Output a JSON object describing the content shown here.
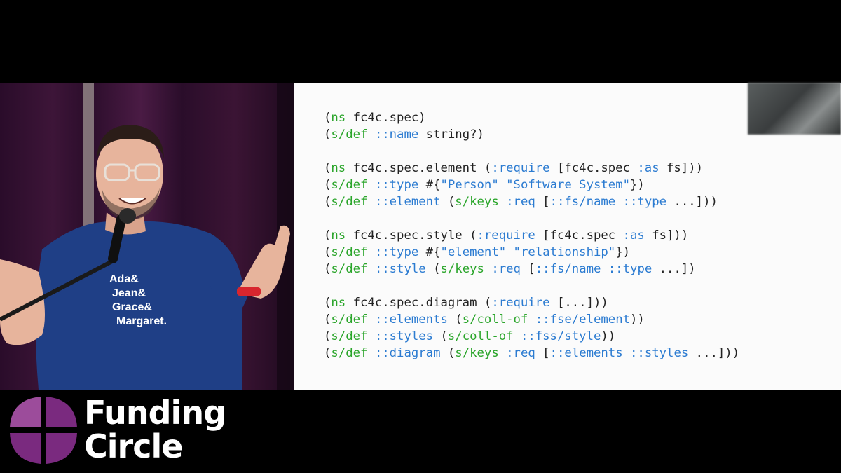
{
  "slide": {
    "code_lines": [
      [
        {
          "t": "(",
          "c": "plain"
        },
        {
          "t": "ns",
          "c": "form"
        },
        {
          "t": " fc4c.spec)",
          "c": "plain"
        }
      ],
      [
        {
          "t": "(",
          "c": "plain"
        },
        {
          "t": "s/def",
          "c": "form"
        },
        {
          "t": " ",
          "c": "plain"
        },
        {
          "t": "::name",
          "c": "kw"
        },
        {
          "t": " string?)",
          "c": "plain"
        }
      ],
      [],
      [
        {
          "t": "(",
          "c": "plain"
        },
        {
          "t": "ns",
          "c": "form"
        },
        {
          "t": " fc4c.spec.element (",
          "c": "plain"
        },
        {
          "t": ":require",
          "c": "kw"
        },
        {
          "t": " [fc4c.spec ",
          "c": "plain"
        },
        {
          "t": ":as",
          "c": "kw"
        },
        {
          "t": " fs]))",
          "c": "plain"
        }
      ],
      [
        {
          "t": "(",
          "c": "plain"
        },
        {
          "t": "s/def",
          "c": "form"
        },
        {
          "t": " ",
          "c": "plain"
        },
        {
          "t": "::type",
          "c": "kw"
        },
        {
          "t": " #{",
          "c": "plain"
        },
        {
          "t": "\"Person\" \"Software System\"",
          "c": "kw"
        },
        {
          "t": "})",
          "c": "plain"
        }
      ],
      [
        {
          "t": "(",
          "c": "plain"
        },
        {
          "t": "s/def",
          "c": "form"
        },
        {
          "t": " ",
          "c": "plain"
        },
        {
          "t": "::element",
          "c": "kw"
        },
        {
          "t": " (",
          "c": "plain"
        },
        {
          "t": "s/keys",
          "c": "form"
        },
        {
          "t": " ",
          "c": "plain"
        },
        {
          "t": ":req",
          "c": "kw"
        },
        {
          "t": " [",
          "c": "plain"
        },
        {
          "t": "::fs/name ::type",
          "c": "kw"
        },
        {
          "t": " ...]))",
          "c": "plain"
        }
      ],
      [],
      [
        {
          "t": "(",
          "c": "plain"
        },
        {
          "t": "ns",
          "c": "form"
        },
        {
          "t": " fc4c.spec.style (",
          "c": "plain"
        },
        {
          "t": ":require",
          "c": "kw"
        },
        {
          "t": " [fc4c.spec ",
          "c": "plain"
        },
        {
          "t": ":as",
          "c": "kw"
        },
        {
          "t": " fs]))",
          "c": "plain"
        }
      ],
      [
        {
          "t": "(",
          "c": "plain"
        },
        {
          "t": "s/def",
          "c": "form"
        },
        {
          "t": " ",
          "c": "plain"
        },
        {
          "t": "::type",
          "c": "kw"
        },
        {
          "t": " #{",
          "c": "plain"
        },
        {
          "t": "\"element\" \"relationship\"",
          "c": "kw"
        },
        {
          "t": "})",
          "c": "plain"
        }
      ],
      [
        {
          "t": "(",
          "c": "plain"
        },
        {
          "t": "s/def",
          "c": "form"
        },
        {
          "t": " ",
          "c": "plain"
        },
        {
          "t": "::style",
          "c": "kw"
        },
        {
          "t": " (",
          "c": "plain"
        },
        {
          "t": "s/keys",
          "c": "form"
        },
        {
          "t": " ",
          "c": "plain"
        },
        {
          "t": ":req",
          "c": "kw"
        },
        {
          "t": " [",
          "c": "plain"
        },
        {
          "t": "::fs/name ::type",
          "c": "kw"
        },
        {
          "t": " ...])",
          "c": "plain"
        }
      ],
      [],
      [
        {
          "t": "(",
          "c": "plain"
        },
        {
          "t": "ns",
          "c": "form"
        },
        {
          "t": " fc4c.spec.diagram (",
          "c": "plain"
        },
        {
          "t": ":require",
          "c": "kw"
        },
        {
          "t": " [...]))",
          "c": "plain"
        }
      ],
      [
        {
          "t": "(",
          "c": "plain"
        },
        {
          "t": "s/def",
          "c": "form"
        },
        {
          "t": " ",
          "c": "plain"
        },
        {
          "t": "::elements",
          "c": "kw"
        },
        {
          "t": " (",
          "c": "plain"
        },
        {
          "t": "s/coll-of",
          "c": "form"
        },
        {
          "t": " ",
          "c": "plain"
        },
        {
          "t": "::fse/element",
          "c": "kw"
        },
        {
          "t": "))",
          "c": "plain"
        }
      ],
      [
        {
          "t": "(",
          "c": "plain"
        },
        {
          "t": "s/def",
          "c": "form"
        },
        {
          "t": " ",
          "c": "plain"
        },
        {
          "t": "::styles",
          "c": "kw"
        },
        {
          "t": " (",
          "c": "plain"
        },
        {
          "t": "s/coll-of",
          "c": "form"
        },
        {
          "t": " ",
          "c": "plain"
        },
        {
          "t": "::fss/style",
          "c": "kw"
        },
        {
          "t": "))",
          "c": "plain"
        }
      ],
      [
        {
          "t": "(",
          "c": "plain"
        },
        {
          "t": "s/def",
          "c": "form"
        },
        {
          "t": " ",
          "c": "plain"
        },
        {
          "t": "::diagram",
          "c": "kw"
        },
        {
          "t": " (",
          "c": "plain"
        },
        {
          "t": "s/keys",
          "c": "form"
        },
        {
          "t": " ",
          "c": "plain"
        },
        {
          "t": ":req",
          "c": "kw"
        },
        {
          "t": " [",
          "c": "plain"
        },
        {
          "t": "::elements ::styles",
          "c": "kw"
        },
        {
          "t": " ...]))",
          "c": "plain"
        }
      ]
    ]
  },
  "speaker": {
    "shirt_lines": [
      "Ada&",
      "Jean&",
      "Grace&",
      "Margaret."
    ]
  },
  "brand": {
    "line1": "Funding",
    "line2": "Circle",
    "colors": {
      "logo_purple": "#7a2a7f",
      "logo_light": "#9c4c9b",
      "code_green": "#2aa52a",
      "code_blue": "#2b7bd1"
    }
  }
}
